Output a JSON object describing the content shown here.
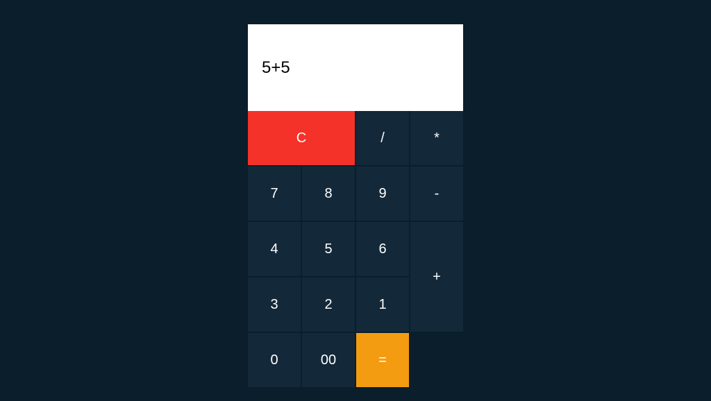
{
  "display": {
    "value": "5+5"
  },
  "keys": {
    "clear": "C",
    "divide": "/",
    "multiply": "*",
    "minus": "-",
    "plus": "+",
    "equals": "=",
    "num7": "7",
    "num8": "8",
    "num9": "9",
    "num4": "4",
    "num5": "5",
    "num6": "6",
    "num3": "3",
    "num2": "2",
    "num1": "1",
    "num0": "0",
    "num00": "00"
  }
}
